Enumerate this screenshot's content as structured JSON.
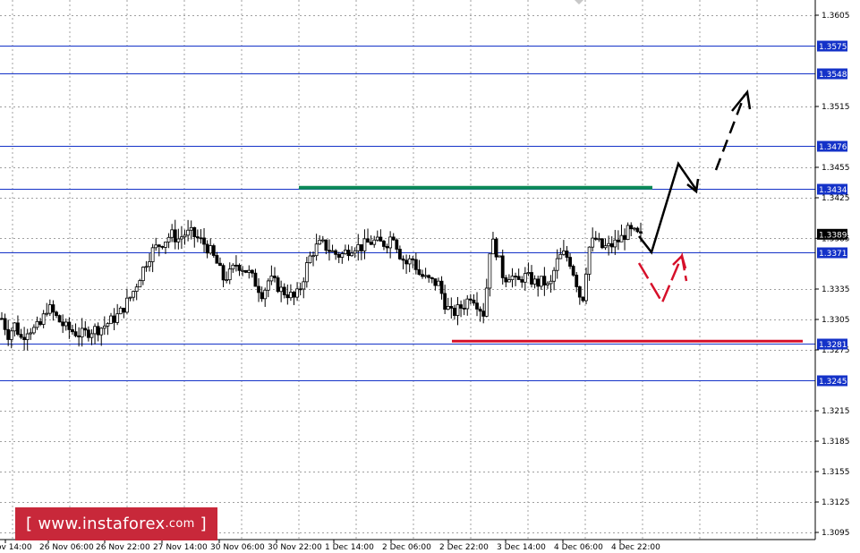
{
  "chart_data": {
    "type": "candlestick",
    "y_ticks": [
      "1.3605",
      "1.3515",
      "1.3455",
      "1.3425",
      "1.3385",
      "1.3335",
      "1.3305",
      "1.3275",
      "1.3215",
      "1.3185",
      "1.3155",
      "1.3125",
      "1.3095"
    ],
    "x_ticks": [
      "ov 14:00",
      "26 Nov 06:00",
      "26 Nov 22:00",
      "27 Nov 14:00",
      "30 Nov 06:00",
      "30 Nov 22:00",
      "1 Dec 14:00",
      "2 Dec 06:00",
      "2 Dec 22:00",
      "3 Dec 14:00",
      "4 Dec 06:00",
      "4 Dec 22:00"
    ],
    "ylim": [
      1.3092,
      1.362
    ],
    "levels": [
      "1.3575",
      "1.3548",
      "1.3476",
      "1.3434",
      "1.3371",
      "1.3281",
      "1.3245"
    ],
    "current_price": "1.3389",
    "support_line": {
      "value": 1.3281,
      "color": "#d6102a"
    },
    "resistance_line": {
      "value": 1.3434,
      "color": "#0c8a57"
    },
    "grid": true,
    "path": [
      [
        1.3306,
        1.329,
        1.33,
        1.3286,
        1.3296,
        1.3295,
        1.33,
        1.3318,
        1.331,
        1.3302,
        1.3296,
        1.3293,
        1.329,
        1.3292,
        1.3295,
        1.3296,
        1.33,
        1.3305,
        1.331,
        1.332,
        1.333,
        1.3345,
        1.336,
        1.3372,
        1.3378,
        1.3383,
        1.3389,
        1.3384,
        1.3389,
        1.339,
        1.3385,
        1.338,
        1.3372,
        1.336,
        1.3345,
        1.335,
        1.336,
        1.3356,
        1.335,
        1.334,
        1.333,
        1.3345,
        1.334,
        1.3333,
        1.333,
        1.3325,
        1.334,
        1.3363,
        1.3375,
        1.338,
        1.3375,
        1.337,
        1.3368,
        1.3373,
        1.3378,
        1.3376,
        1.338,
        1.3382,
        1.338,
        1.338,
        1.339,
        1.337,
        1.336,
        1.3365,
        1.335,
        1.3345,
        1.3342,
        1.334,
        1.332,
        1.331,
        1.3315,
        1.332,
        1.333,
        1.332,
        1.331,
        1.3385,
        1.337,
        1.3345,
        1.335,
        1.334,
        1.3348,
        1.3345,
        1.334,
        1.3343,
        1.3335,
        1.336,
        1.337,
        1.3365,
        1.3345,
        1.332,
        1.3375,
        1.3385,
        1.3376,
        1.3376,
        1.338,
        1.3385,
        1.3392,
        1.339,
        1.3386
      ]
    ],
    "scenario_arrows": [
      "bullish-solid-then-dashed",
      "bearish-dashed"
    ]
  },
  "logo": {
    "bracket_left": "[",
    "name": "www.instaforex",
    "suffix": ".com",
    "bracket_right": "]"
  },
  "colors": {
    "level_line": "#1432c8",
    "level_label_bg": "#1432c8",
    "price_label_bg": "#000000",
    "candle": "#000000",
    "grid": "#a0a0a0",
    "logo_bg": "#c8283a"
  }
}
